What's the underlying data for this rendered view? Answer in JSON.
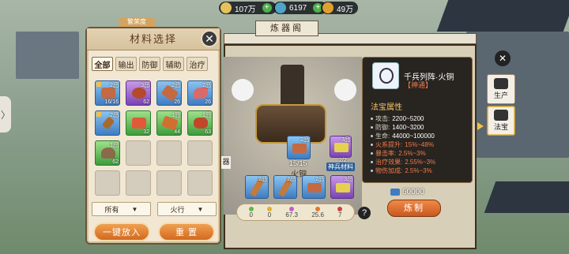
{
  "resources": [
    {
      "name": "ingot",
      "value": "107万",
      "color": "#e7c25c"
    },
    {
      "name": "jade",
      "value": "6197",
      "color": "#4fa5c9"
    },
    {
      "name": "gold",
      "value": "49万",
      "color": "#e0a030"
    }
  ],
  "material_panel": {
    "tag": "繁荣度",
    "title": "材料选择",
    "tabs": [
      "全部",
      "输出",
      "防御",
      "辅助",
      "治疗"
    ],
    "active_tab": 0,
    "items": [
      {
        "tier": "2品",
        "count": "16/16",
        "rarity": "blue",
        "item_color": "#c46a42"
      },
      {
        "tier": "3品",
        "count": "62",
        "rarity": "purple",
        "item_color": "#b44a2a"
      },
      {
        "tier": "2品",
        "count": "26",
        "rarity": "blue",
        "item_color": "#c46a42"
      },
      {
        "tier": "2品",
        "count": "26",
        "rarity": "blue",
        "item_color": "#d86a6a"
      },
      {
        "tier": "2品",
        "count": "",
        "rarity": "blue",
        "item_color": "#a86a2a"
      },
      {
        "tier": "",
        "count": "32",
        "rarity": "green",
        "item_color": "#e05a3a"
      },
      {
        "tier": "1品",
        "count": "44",
        "rarity": "green",
        "item_color": "#d07030"
      },
      {
        "tier": "1品",
        "count": "63",
        "rarity": "green",
        "item_color": "#c04828"
      },
      {
        "tier": "1品",
        "count": "62",
        "rarity": "green",
        "item_color": "#8a6a4a"
      }
    ],
    "filter_grade": "所有",
    "filter_element": "火行",
    "auto_fill_label": "一键放入",
    "reset_label": "重 置"
  },
  "forge": {
    "title": "炼器阁",
    "main_tier": "2品",
    "main_count": "15/15",
    "main_label": "火铜",
    "side_tier": "3品",
    "side_count": "2/2",
    "side_label": "神兵材料",
    "slots": [
      {
        "tier": "2品"
      },
      {
        "tier": "2品"
      },
      {
        "tier": "2品"
      },
      {
        "tier": "3品"
      }
    ],
    "elements": [
      "0",
      "0",
      "67.3",
      "25.6",
      "7"
    ],
    "help": "?",
    "cost": "60000",
    "make_label": "炼制"
  },
  "tooltip": {
    "name": "千兵列阵·火铜",
    "rank": "【神通】",
    "header": "法宝属性",
    "stats": [
      {
        "label": "攻击:",
        "value": "2200~5200",
        "hl": false
      },
      {
        "label": "防御:",
        "value": "1400~3200",
        "hl": false
      },
      {
        "label": "生命:",
        "value": "44000~100000",
        "hl": false
      },
      {
        "label": "火系提升:",
        "value": "15%~48%",
        "hl": true
      },
      {
        "label": "暴击率:",
        "value": "2.5%~3%",
        "hl": true
      },
      {
        "label": "治疗效果:",
        "value": "2.55%~3%",
        "hl": true
      },
      {
        "label": "物伤加成:",
        "value": "2.5%~3%",
        "hl": true
      }
    ]
  },
  "side_menu": [
    {
      "label": "生产"
    },
    {
      "label": "法宝"
    }
  ],
  "left_stub": "器"
}
